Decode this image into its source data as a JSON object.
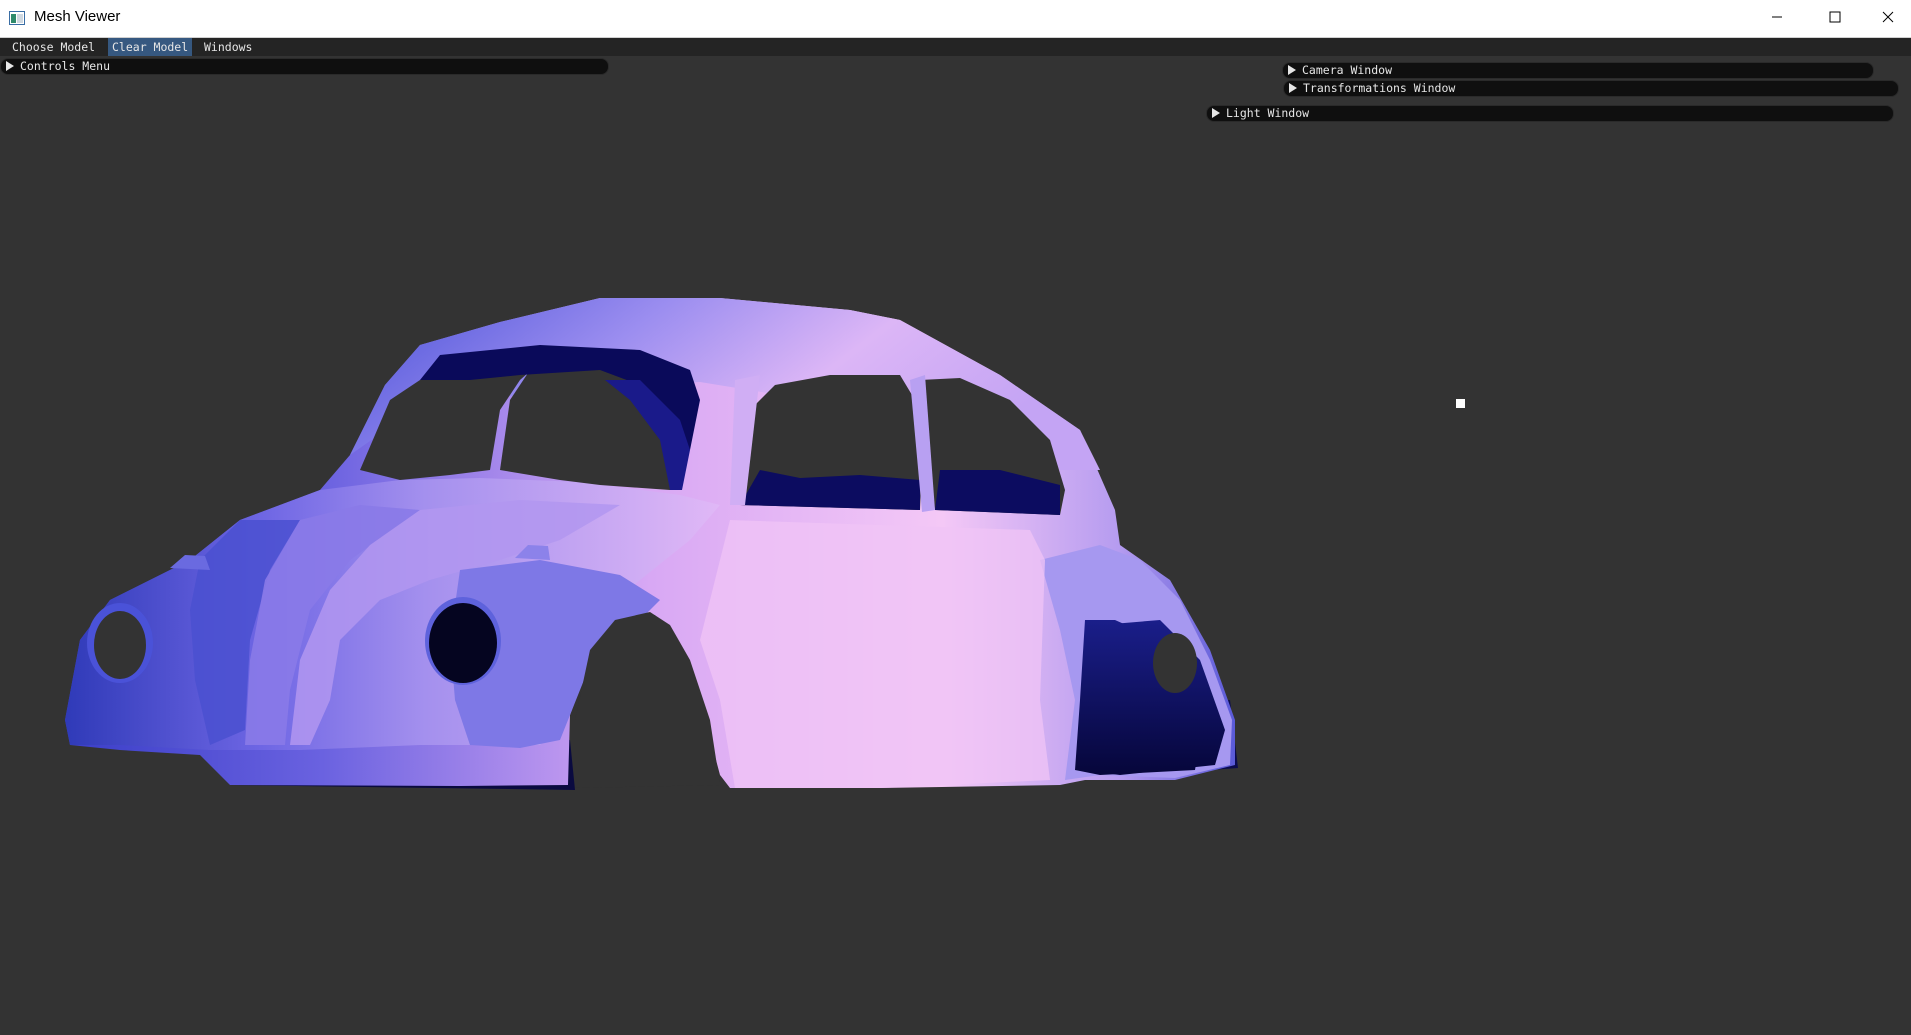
{
  "window": {
    "title": "Mesh Viewer",
    "minimize_icon": "minimize-icon",
    "maximize_icon": "maximize-icon",
    "close_icon": "close-icon"
  },
  "menu": {
    "items": [
      {
        "label": "Choose Model",
        "active": false
      },
      {
        "label": "Clear Model",
        "active": true
      },
      {
        "label": "Windows",
        "active": false
      }
    ]
  },
  "panels": {
    "controls": {
      "label": "Controls Menu",
      "collapsed": true
    },
    "camera": {
      "label": "Camera Window",
      "collapsed": true
    },
    "transformations": {
      "label": "Transformations Window",
      "collapsed": true
    },
    "light": {
      "label": "Light Window",
      "collapsed": true
    }
  },
  "scene": {
    "background": "#333333",
    "model": "car-mesh",
    "color_light": "#f4c4f4",
    "color_mid": "#9a8af0",
    "color_dark": "#0c0c5a",
    "light_source_marker": "light-marker"
  }
}
